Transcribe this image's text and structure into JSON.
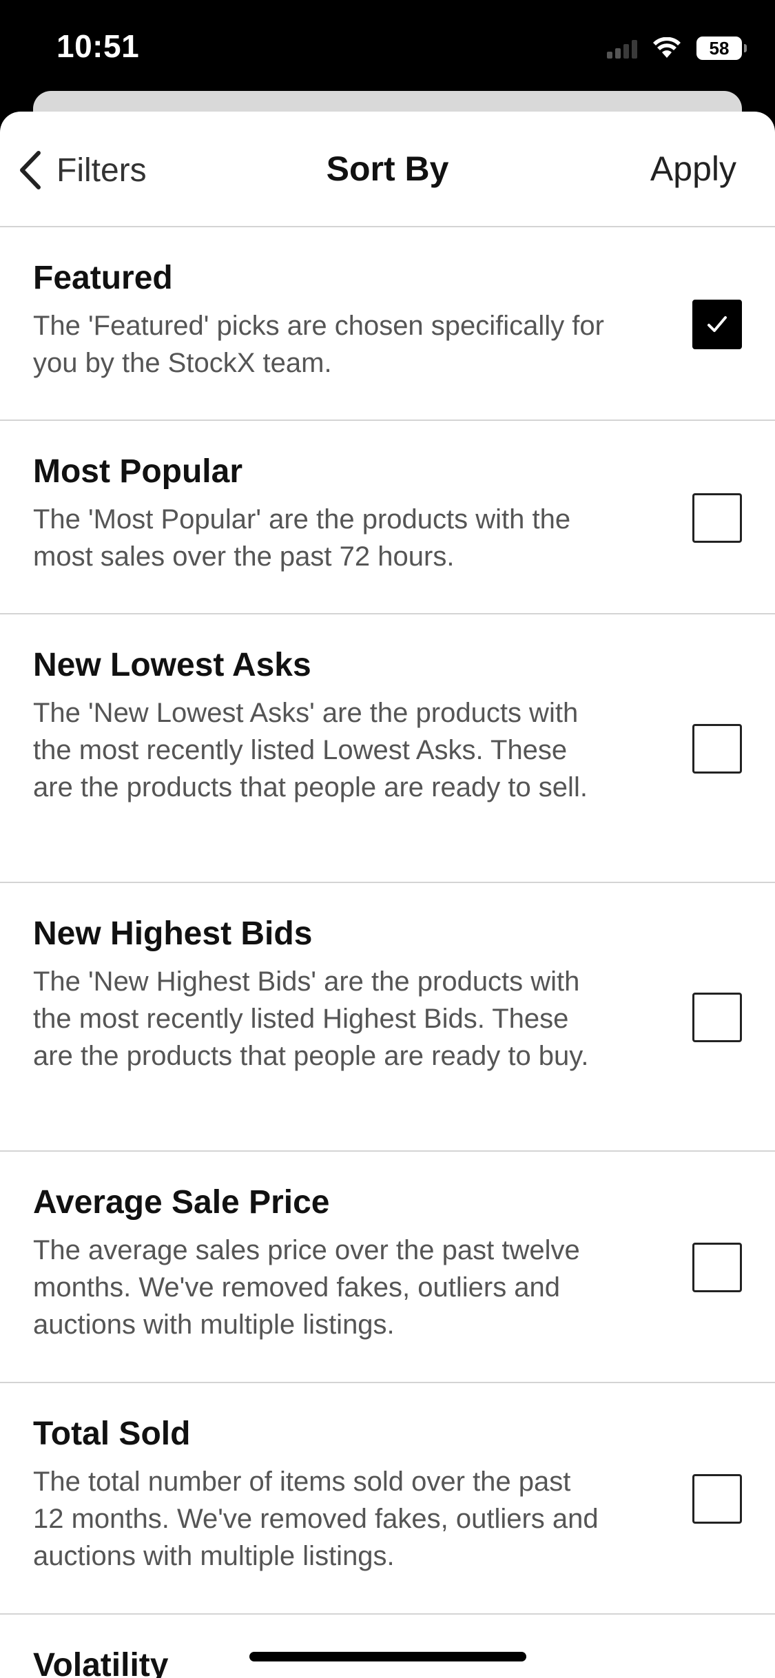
{
  "status_bar": {
    "time": "10:51",
    "battery": "58",
    "icons": [
      "cellular-signal-icon",
      "wifi-icon",
      "battery-icon"
    ]
  },
  "nav": {
    "back_label": "Filters",
    "back_icon": "chevron-left-icon",
    "title": "Sort By",
    "apply_label": "Apply"
  },
  "options": [
    {
      "title": "Featured",
      "description": "The 'Featured' picks are chosen specifically for you by the StockX team.",
      "checked": true
    },
    {
      "title": "Most Popular",
      "description": "The 'Most Popular' are the products with the most sales over the past 72 hours.",
      "checked": false
    },
    {
      "title": "New Lowest Asks",
      "description": "The 'New Lowest Asks' are the products with the most recently listed Lowest Asks. These are the products that people are ready to sell.",
      "checked": false
    },
    {
      "title": "New Highest Bids",
      "description": "The 'New Highest Bids' are the products with the most recently listed Highest Bids. These are the products that people are ready to buy.",
      "checked": false
    },
    {
      "title": "Average Sale Price",
      "description": "The average sales price over the past twelve months. We've removed fakes, outliers and auctions with multiple listings.",
      "checked": false
    },
    {
      "title": "Total Sold",
      "description": "The total number of items sold over the past 12 months. We've removed fakes, outliers and auctions with multiple listings.",
      "checked": false
    },
    {
      "title": "Volatility",
      "description": "",
      "checked": false
    }
  ]
}
